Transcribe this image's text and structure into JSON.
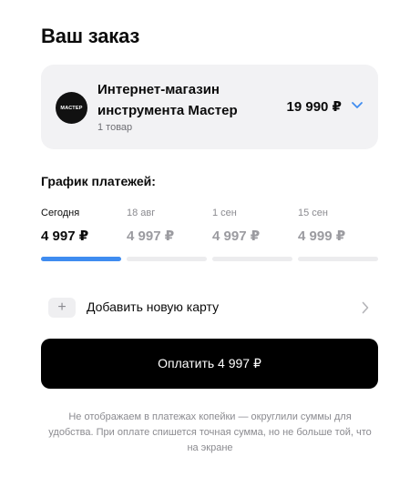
{
  "header": {
    "title": "Ваш заказ"
  },
  "merchant": {
    "logo_text": "МАСТЕР",
    "name": "Интернет-магазин инструмента Мастер",
    "items_count": "1 товар",
    "total": "19 990 ₽"
  },
  "schedule": {
    "title": "График платежей:",
    "payments": [
      {
        "date": "Сегодня",
        "amount": "4 997 ₽",
        "active": true
      },
      {
        "date": "18 авг",
        "amount": "4 997 ₽",
        "active": false
      },
      {
        "date": "1 сен",
        "amount": "4 997 ₽",
        "active": false
      },
      {
        "date": "15 сен",
        "amount": "4 999 ₽",
        "active": false
      }
    ]
  },
  "add_card": {
    "plus": "+",
    "label": "Добавить новую карту"
  },
  "pay_button": {
    "label": "Оплатить 4 997 ₽"
  },
  "note": "Не отображаем в платежах копейки — округлили суммы для удобства. При оплате спишется точная сумма, но не больше той, что на экране",
  "colors": {
    "accent": "#3f8cf0",
    "button": "#000000",
    "card_bg": "#f2f2f4"
  }
}
